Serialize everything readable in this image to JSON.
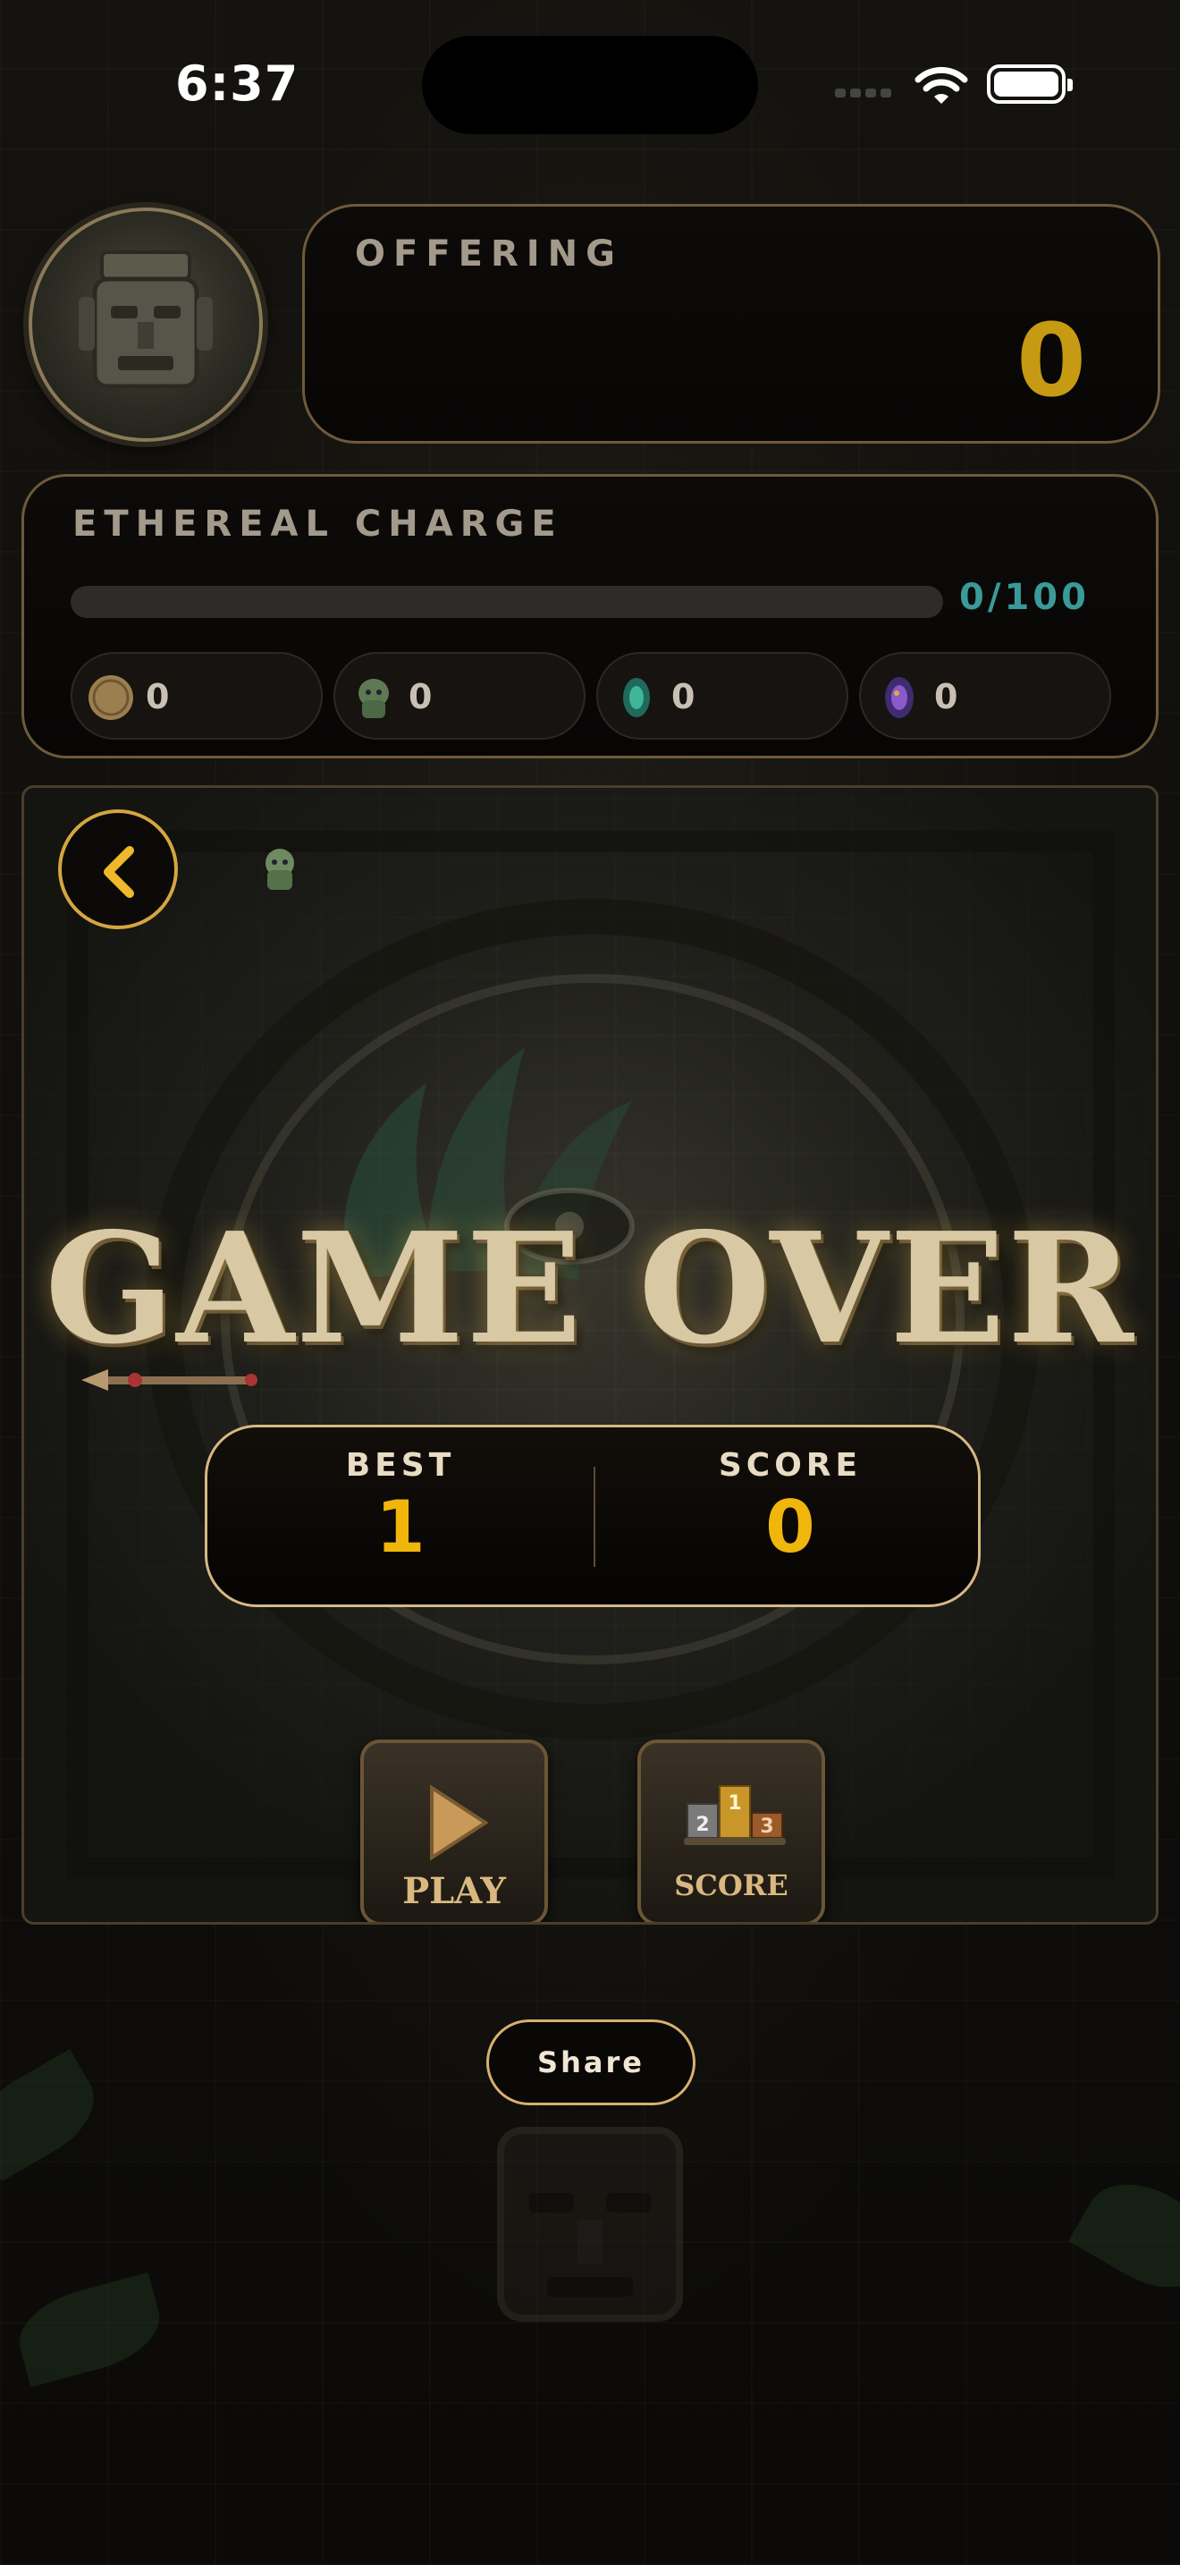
{
  "status_bar": {
    "time": "6:37"
  },
  "offering": {
    "label": "OFFERING",
    "value": "0"
  },
  "ethereal_charge": {
    "label": "ETHEREAL CHARGE",
    "progress_fraction": 0,
    "count_text": "0/100",
    "resources": [
      {
        "icon": "gold-coin-icon",
        "count": "0"
      },
      {
        "icon": "green-idol-icon",
        "count": "0"
      },
      {
        "icon": "emerald-gem-icon",
        "count": "0"
      },
      {
        "icon": "purple-gem-icon",
        "count": "0"
      }
    ]
  },
  "game": {
    "title": "GAME OVER",
    "best_label": "BEST",
    "best_value": "1",
    "score_label": "SCORE",
    "score_value": "0",
    "play_label": "PLAY",
    "scoreboard_label": "SCORE",
    "podium_numbers": [
      "2",
      "1",
      "3"
    ]
  },
  "share_label": "Share",
  "colors": {
    "gold_value": "#c69a12",
    "score_value": "#f1b60c",
    "charge_teal": "#3a9a98",
    "panel_border": "#6e5a3c"
  }
}
